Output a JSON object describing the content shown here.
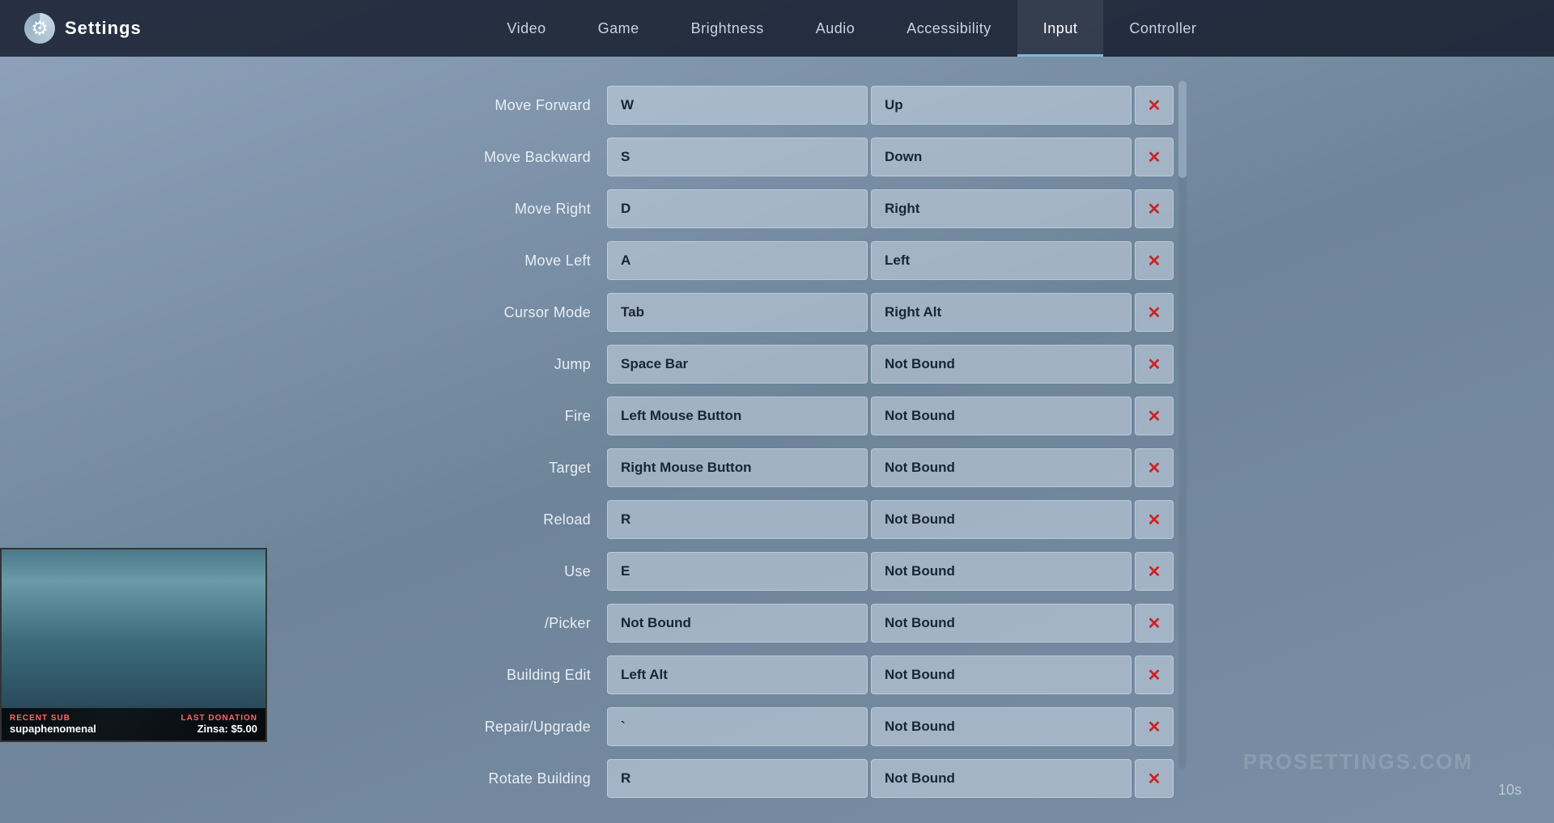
{
  "window": {
    "title": "Settings"
  },
  "titlebar": {
    "minimize": "─",
    "maximize": "□",
    "close": "✕"
  },
  "header": {
    "app_title": "Settings",
    "nav_tabs": [
      {
        "id": "video",
        "label": "Video",
        "active": false
      },
      {
        "id": "game",
        "label": "Game",
        "active": false
      },
      {
        "id": "brightness",
        "label": "Brightness",
        "active": false
      },
      {
        "id": "audio",
        "label": "Audio",
        "active": false
      },
      {
        "id": "accessibility",
        "label": "Accessibility",
        "active": false
      },
      {
        "id": "input",
        "label": "Input",
        "active": true
      },
      {
        "id": "controller",
        "label": "Controller",
        "active": false
      }
    ]
  },
  "bindings": [
    {
      "action": "Move Forward",
      "primary": "W",
      "alt": "Up"
    },
    {
      "action": "Move Backward",
      "primary": "S",
      "alt": "Down"
    },
    {
      "action": "Move Right",
      "primary": "D",
      "alt": "Right"
    },
    {
      "action": "Move Left",
      "primary": "A",
      "alt": "Left"
    },
    {
      "action": "Cursor Mode",
      "primary": "Tab",
      "alt": "Right Alt"
    },
    {
      "action": "Jump",
      "primary": "Space Bar",
      "alt": "Not Bound"
    },
    {
      "action": "Fire",
      "primary": "Left Mouse Button",
      "alt": "Not Bound"
    },
    {
      "action": "Target",
      "primary": "Right Mouse Button",
      "alt": "Not Bound"
    },
    {
      "action": "Reload",
      "primary": "R",
      "alt": "Not Bound"
    },
    {
      "action": "Use",
      "primary": "E",
      "alt": "Not Bound"
    },
    {
      "action": "/Picker",
      "primary": "Not Bound",
      "alt": "Not Bound"
    },
    {
      "action": "Building Edit",
      "primary": "Left Alt",
      "alt": "Not Bound"
    },
    {
      "action": "Repair/Upgrade",
      "primary": "`",
      "alt": "Not Bound"
    },
    {
      "action": "Rotate Building",
      "primary": "R",
      "alt": "Not Bound"
    }
  ],
  "webcam": {
    "recent_sub_label": "RECENT SUB",
    "streamer_name": "supaphenomenal",
    "last_donation_label": "LAST DONATION",
    "donation_amount": "Zinsa: $5.00"
  },
  "watermark": {
    "text": "PROSETTINGS.COM",
    "timer": "10s"
  }
}
